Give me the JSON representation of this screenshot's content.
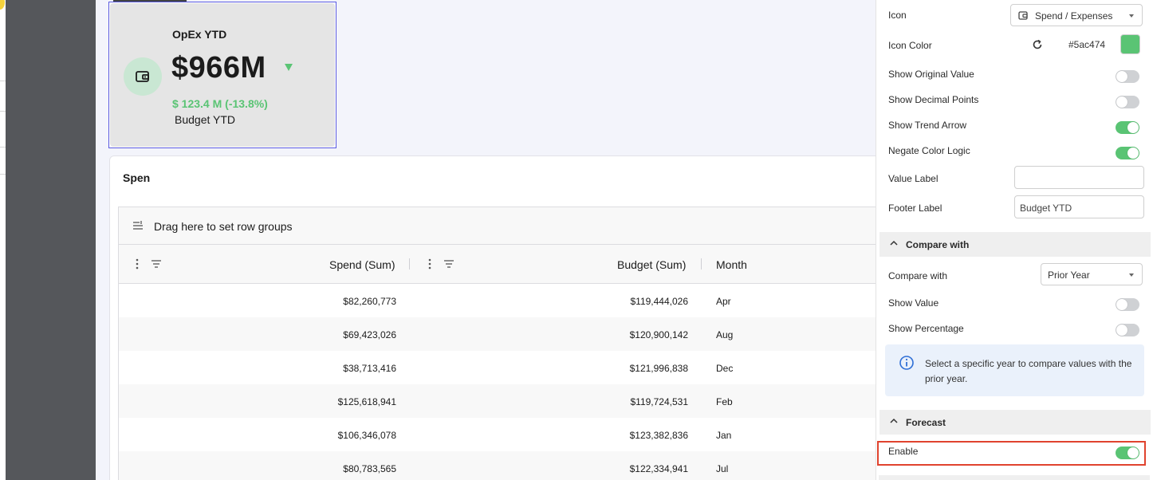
{
  "kpi": {
    "title": "OpEx YTD",
    "value": "$966M",
    "delta": "$ 123.4 M (-13.8%)",
    "footer": "Budget YTD"
  },
  "table": {
    "title": "Spen",
    "group_bar_text": "Drag here to set row groups",
    "columns": [
      "Spend (Sum)",
      "Budget (Sum)",
      "Month"
    ],
    "rows": [
      {
        "spend": "$82,260,773",
        "budget": "$119,444,026",
        "month": "Apr"
      },
      {
        "spend": "$69,423,026",
        "budget": "$120,900,142",
        "month": "Aug"
      },
      {
        "spend": "$38,713,416",
        "budget": "$121,996,838",
        "month": "Dec"
      },
      {
        "spend": "$125,618,941",
        "budget": "$119,724,531",
        "month": "Feb"
      },
      {
        "spend": "$106,346,078",
        "budget": "$123,382,836",
        "month": "Jan"
      },
      {
        "spend": "$80,783,565",
        "budget": "$122,334,941",
        "month": "Jul"
      }
    ]
  },
  "settings": {
    "icon_label": "Icon",
    "icon_value": "Spend / Expenses",
    "icon_color_label": "Icon Color",
    "icon_color_value": "#5ac474",
    "toggles": [
      {
        "label": "Show Original Value",
        "on": false
      },
      {
        "label": "Show Decimal Points",
        "on": false
      },
      {
        "label": "Show Trend Arrow",
        "on": true
      },
      {
        "label": "Negate Color Logic",
        "on": true
      }
    ],
    "value_label_label": "Value Label",
    "value_label_value": "",
    "footer_label_label": "Footer Label",
    "footer_label_value": "Budget YTD",
    "compare_section": "Compare with",
    "compare_with_label": "Compare with",
    "compare_with_value": "Prior Year",
    "show_value_label": "Show Value",
    "show_percentage_label": "Show Percentage",
    "info_text": "Select a specific year to compare values with the prior year.",
    "forecast_section": "Forecast",
    "enable_label": "Enable"
  },
  "colors": {
    "accent": "#5ac474",
    "highlight": "#e0432e",
    "selection": "#5a5ae0"
  }
}
